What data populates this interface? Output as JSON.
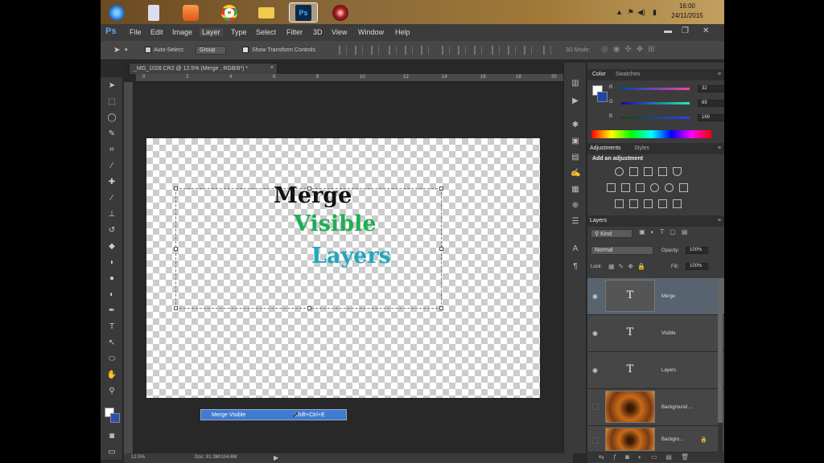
{
  "taskbar": {
    "icons": [
      "start-orb-icon",
      "file-icon",
      "media-player-icon",
      "chrome-icon",
      "folder-icon",
      "photoshop-icon",
      "disc-icon"
    ],
    "time": "16:00",
    "date": "24/11/2015"
  },
  "app": {
    "logo": "Ps"
  },
  "menu": [
    "File",
    "Edit",
    "Image",
    "Layer",
    "Type",
    "Select",
    "Filter",
    "3D",
    "View",
    "Window",
    "Help"
  ],
  "options": {
    "auto_select_label": "Auto-Select:",
    "auto_select_value": "Group",
    "show_transform_label": "Show Transform Controls",
    "mode_3d": "3D Mode:"
  },
  "document": {
    "tab_title": "_MG_1028.CR2 @ 12.5% (Merge , RGB/8*) *",
    "ruler_ticks": [
      "0",
      "2",
      "4",
      "6",
      "8",
      "10",
      "12",
      "14",
      "16",
      "18",
      "20"
    ],
    "words": [
      {
        "text": "Merge",
        "color": "#111111"
      },
      {
        "text": "Visible",
        "color": "#1fae55"
      },
      {
        "text": "Layers",
        "color": "#22a6bf"
      }
    ]
  },
  "tooltip": {
    "label": "Merge Visible",
    "shortcut": "Shift+Ctrl+E"
  },
  "status": {
    "zoom": "12.5%",
    "doc": "Doc: 81.3M/104.6M"
  },
  "color_panel": {
    "tabs": [
      "Color",
      "Swatches"
    ],
    "r": "32",
    "g": "69",
    "b": "169",
    "labels": [
      "R",
      "G",
      "B"
    ]
  },
  "adjustments": {
    "tabs": [
      "Adjustments",
      "Styles"
    ],
    "heading": "Add an adjustment"
  },
  "layers": {
    "tab": "Layers",
    "filter": "Kind",
    "blend": "Normal",
    "opacity_label": "Opacity:",
    "opacity": "100%",
    "lock_label": "Lock:",
    "fill_label": "Fill:",
    "fill": "100%",
    "items": [
      {
        "name": "Merge",
        "type": "text",
        "visible": true,
        "selected": true
      },
      {
        "name": "Visible",
        "type": "text",
        "visible": true,
        "selected": false
      },
      {
        "name": "Layers",
        "type": "text",
        "visible": true,
        "selected": false
      },
      {
        "name": "Background ...",
        "type": "image",
        "visible": false,
        "selected": false
      },
      {
        "name": "Backgro...",
        "type": "image",
        "visible": false,
        "selected": false
      }
    ]
  }
}
